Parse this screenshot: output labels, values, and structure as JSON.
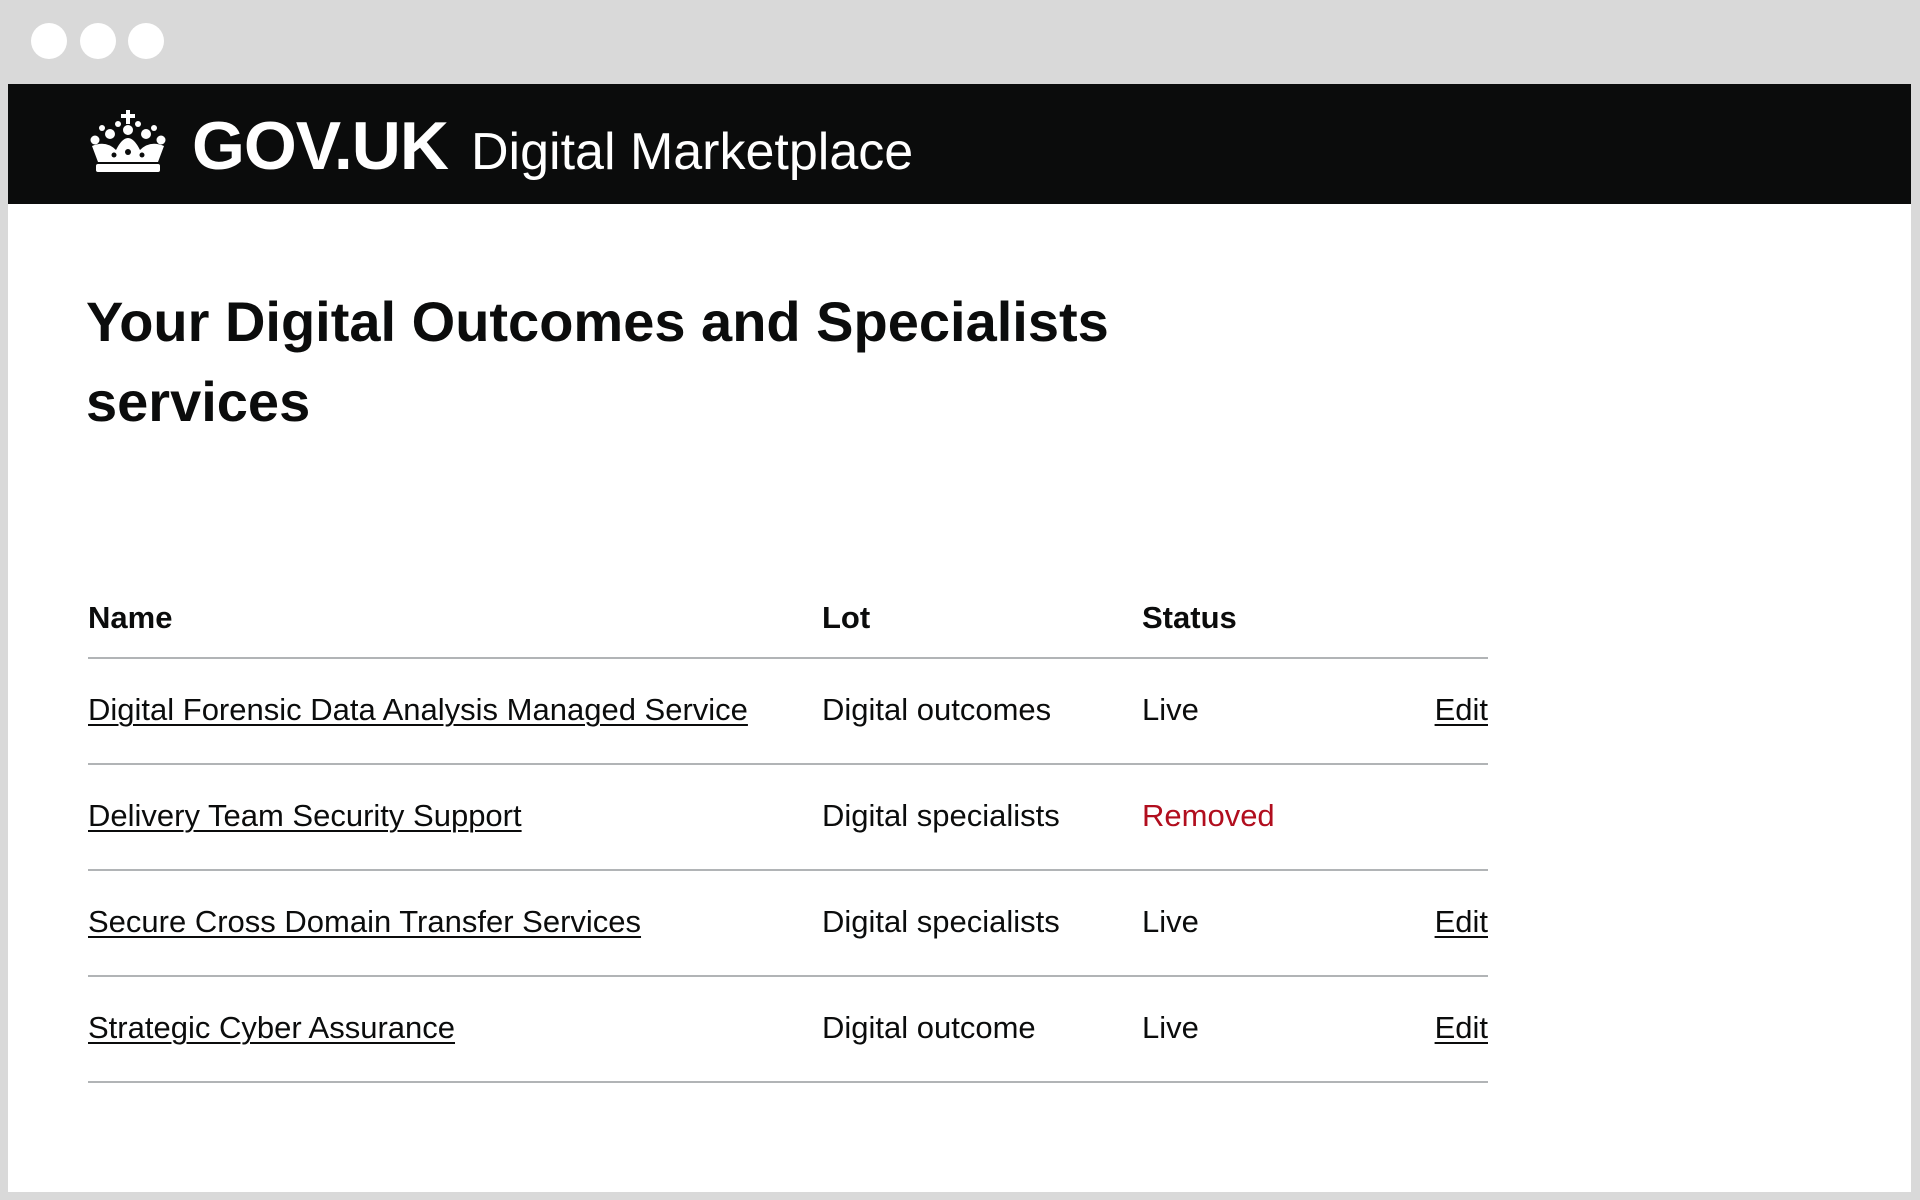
{
  "header": {
    "logo_text": "GOV.UK",
    "service_name": "Digital Marketplace"
  },
  "page": {
    "title": "Your Digital Outcomes and Specialists services"
  },
  "table": {
    "headers": {
      "name": "Name",
      "lot": "Lot",
      "status": "Status"
    },
    "rows": [
      {
        "name": "Digital Forensic Data Analysis Managed Service",
        "lot": "Digital outcomes",
        "status": "Live",
        "action": "Edit"
      },
      {
        "name": "Delivery Team Security Support",
        "lot": "Digital specialists",
        "status": "Removed",
        "action": ""
      },
      {
        "name": "Secure Cross Domain Transfer Services",
        "lot": "Digital specialists",
        "status": "Live",
        "action": "Edit"
      },
      {
        "name": "Strategic Cyber Assurance",
        "lot": "Digital outcome",
        "status": "Live",
        "action": "Edit"
      }
    ]
  },
  "colors": {
    "header_bg": "#0b0c0c",
    "link": "#1d70b8",
    "removed": "#b10e1e",
    "divider": "#b1b4b6"
  },
  "icons": {
    "logo": "crown-icon"
  }
}
